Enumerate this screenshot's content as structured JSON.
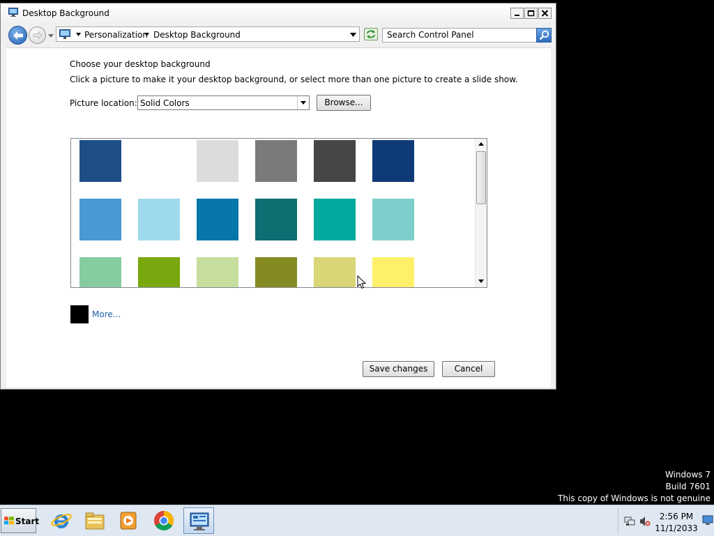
{
  "window": {
    "title": "Desktop Background",
    "controls": {
      "minimize": "minimize",
      "maximize": "maximize",
      "close": "close"
    }
  },
  "address_bar": {
    "crumbs": [
      "Personalization",
      "Desktop Background"
    ],
    "search_placeholder": "Search Control Panel"
  },
  "content": {
    "heading": "Choose your desktop background",
    "subheading": "Click a picture to make it your desktop background, or select more than one picture to create a slide show.",
    "picture_location_label": "Picture location:",
    "picture_location_value": "Solid Colors",
    "browse_label": "Browse...",
    "swatch_rows": [
      [
        "#1f4e86",
        "#ffffff",
        "#dcdcdc",
        "#7a7a7a",
        "#464646",
        "#0f3a78"
      ],
      [
        "#4a98d4",
        "#9fd9ec",
        "#0776a8",
        "#0e6e72",
        "#02a99f",
        "#7ecfcb"
      ],
      [
        "#86cca0",
        "#78a70e",
        "#c6df9e",
        "#868a22",
        "#d8d676",
        "#fff06a"
      ]
    ],
    "more_color": "#000000",
    "more_label": "More...",
    "save_label": "Save changes",
    "cancel_label": "Cancel"
  },
  "watermark": {
    "line1": "Windows 7",
    "line2": "Build 7601",
    "line3": "This copy of Windows is not genuine"
  },
  "taskbar": {
    "start_label": "Start",
    "apps": [
      "internet-explorer",
      "windows-explorer",
      "media-player",
      "chrome",
      "control-panel"
    ],
    "clock_time": "2:56 PM",
    "clock_date": "11/1/2033"
  }
}
